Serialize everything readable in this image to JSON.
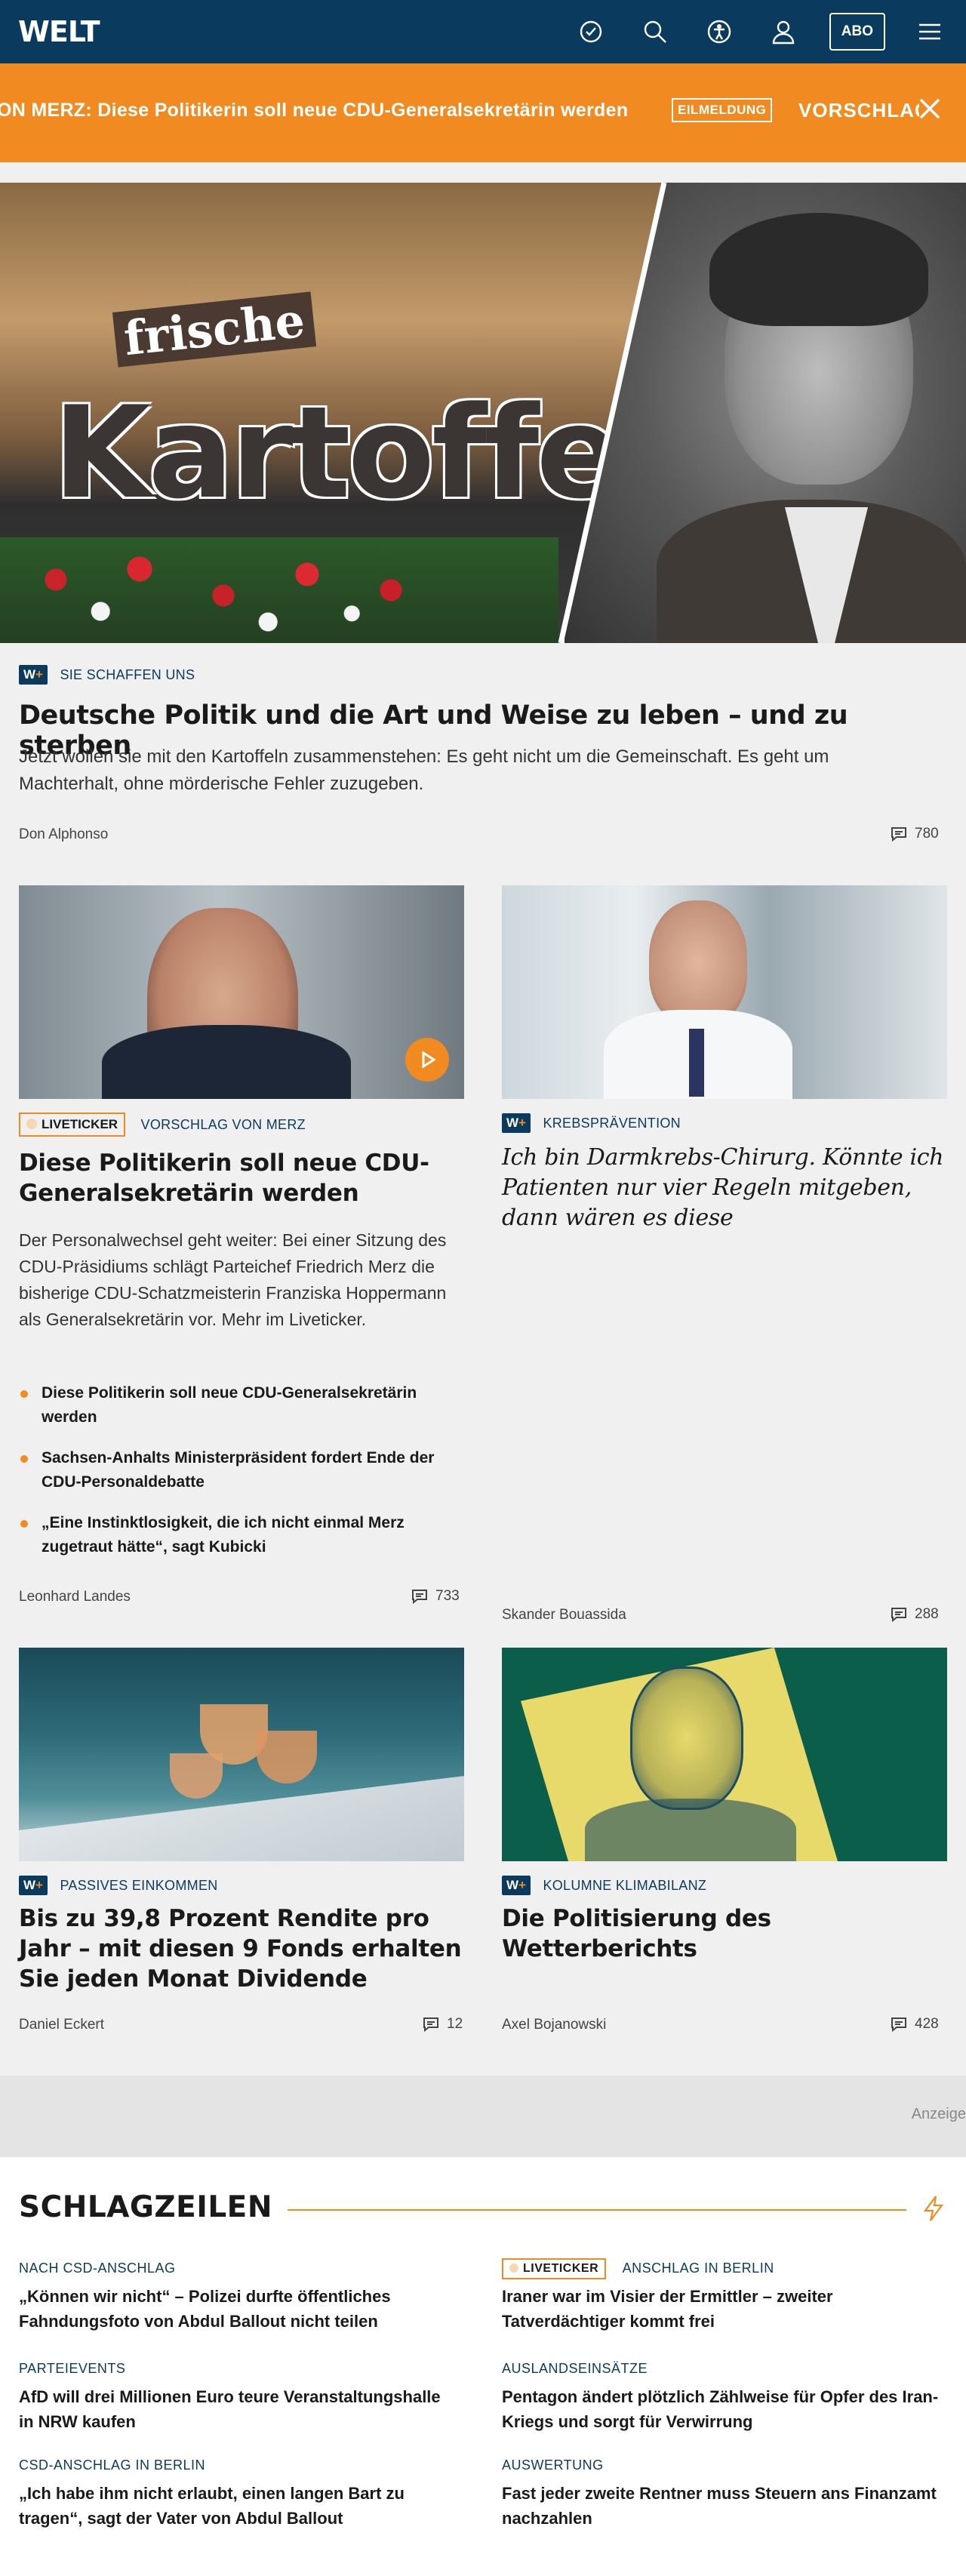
{
  "header": {
    "logo": "WELT",
    "abo_label": "ABO",
    "icons": [
      "history-icon",
      "search-icon",
      "accessibility-icon",
      "user-icon",
      "menu-icon"
    ]
  },
  "ticker": {
    "text": "ON MERZ: Diese Politikerin soll neue CDU-Generalsekretärin werden",
    "badge": "EILMELDUNG",
    "next": "VORSCHLAG VON MERZ"
  },
  "hero": {
    "kicker": "SIE SCHAFFEN UNS",
    "plus_label": "W+",
    "image_text_1": "frische",
    "image_text_2": "Kartoffeln",
    "title": "Deutsche Politik und die Art und Weise zu leben – und zu sterben",
    "teaser": "Jetzt wollen sie mit den Kartoffeln zusammenstehen: Es geht nicht um die Gemeinschaft. Es geht um Machterhalt, ohne mörderische Fehler zuzugeben.",
    "author": "Don Alphonso",
    "comments": "780"
  },
  "cards": [
    {
      "badge": "LIVETICKER",
      "kicker": "VORSCHLAG VON MERZ",
      "title": "Diese Politikerin soll neue CDU-Generalsekretärin werden",
      "teaser": "Der Personalwechsel geht weiter: Bei einer Sitzung des CDU-Präsidiums schlägt Parteichef Friedrich Merz die bisherige CDU-Schatzmeisterin Franziska Hoppermann als Generalsekretärin vor. Mehr im Liveticker.",
      "bullets": [
        "Diese Politikerin soll neue CDU-Generalsekretärin werden",
        "Sachsen-Anhalts Ministerpräsident fordert Ende der CDU-Personaldebatte",
        "„Eine Instinktlosigkeit, die ich nicht einmal Merz zugetraut hätte“, sagt Kubicki"
      ],
      "author": "Leonhard Landes",
      "comments": "733"
    },
    {
      "plus_label": "W+",
      "kicker": "KREBSPRÄVENTION",
      "title": "Ich bin Darmkrebs-Chirurg. Könnte ich Patienten nur vier Regeln mitgeben, dann wären es diese",
      "author": "Skander Bouassida",
      "comments": "288"
    },
    {
      "plus_label": "W+",
      "kicker": "PASSIVES EINKOMMEN",
      "title": "Bis zu 39,8 Prozent Rendite pro Jahr – mit diesen 9 Fonds erhalten Sie jeden Monat Dividende",
      "author": "Daniel Eckert",
      "comments": "12"
    },
    {
      "plus_label": "W+",
      "kicker": "KOLUMNE KLIMABILANZ",
      "title": "Die Politisierung des Wetterberichts",
      "author": "Axel Bojanowski",
      "comments": "428"
    }
  ],
  "ad": {
    "label": "Anzeige"
  },
  "schlagzeilen": {
    "title": "SCHLAGZEILEN",
    "items": [
      {
        "kicker": "NACH CSD-ANSCHLAG",
        "title": "„Können wir nicht“ – Polizei durfte öffentliches Fahndungsfoto von Abdul Ballout nicht teilen"
      },
      {
        "badge": "LIVETICKER",
        "kicker": "ANSCHLAG IN BERLIN",
        "title": "Iraner war im Visier der Ermittler – zweiter Tatverdächtiger kommt frei"
      },
      {
        "kicker": "PARTEIEVENTS",
        "title": "AfD will drei Millionen Euro teure Veranstaltungshalle in NRW kaufen"
      },
      {
        "kicker": "AUSLANDSEINSÄTZE",
        "title": "Pentagon ändert plötzlich Zählweise für Opfer des Iran-Kriegs und sorgt für Verwirrung"
      },
      {
        "kicker": "CSD-ANSCHLAG IN BERLIN",
        "title": "„Ich habe ihm nicht erlaubt, einen langen Bart zu tragen“, sagt der Vater von Abdul Ballout"
      },
      {
        "kicker": "AUSWERTUNG",
        "title": "Fast jeder zweite Rentner muss Steuern ans Finanzamt nachzahlen"
      }
    ]
  },
  "colors": {
    "brand": "#0a3b5e",
    "accent": "#f18b21"
  }
}
